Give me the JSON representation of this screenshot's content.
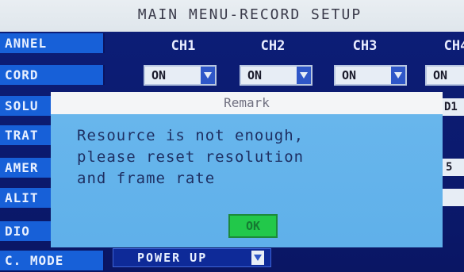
{
  "header": {
    "title": "MAIN MENU-RECORD SETUP"
  },
  "sidebar": {
    "items": [
      "ANNEL",
      "CORD",
      "SOLU",
      "TRAT",
      "AMER",
      "ALIT",
      "DIO",
      "C. MODE"
    ]
  },
  "channels": [
    "CH1",
    "CH2",
    "CH3",
    "CH4"
  ],
  "record_values": [
    "ON",
    "ON",
    "ON",
    "ON"
  ],
  "partial_values": [
    "D1",
    "5"
  ],
  "mode_value": "POWER UP",
  "dialog": {
    "title": "Remark",
    "message_lines": [
      "Resource is not enough,",
      "please reset resolution",
      "and frame rate"
    ],
    "ok_label": "OK"
  },
  "colors": {
    "screen_bg": "#0b1a6e",
    "sidebar_blue": "#1760d8",
    "dialog_blue": "#5fb0ea",
    "ok_green": "#22c84a"
  }
}
